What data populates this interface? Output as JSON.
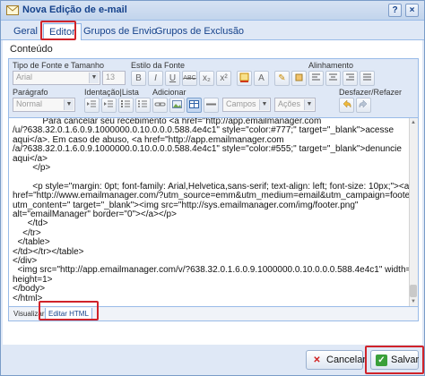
{
  "window": {
    "title": "Nova Edição de e-mail",
    "help_glyph": "?",
    "close_glyph": "×"
  },
  "tabs": [
    {
      "label": "Geral"
    },
    {
      "label": "Editor"
    },
    {
      "label": "Grupos de Envio"
    },
    {
      "label": "Grupos de Exclusão"
    }
  ],
  "panel": {
    "title": "Conteúdo"
  },
  "toolbar": {
    "labels": {
      "font_type_size": "Tipo de Fonte e Tamanho",
      "font_style": "Estilo da Fonte",
      "alignment": "Alinhamento",
      "paragraph": "Parágrafo",
      "indent_list": "Identação|Lista",
      "add": "Adicionar",
      "undo_redo": "Desfazer/Refazer"
    },
    "font_family": "Arial",
    "font_size": "13",
    "paragraph": "Normal",
    "fields": "Campos",
    "actions": "Ações",
    "style_buttons": [
      "B",
      "I",
      "U",
      "ABC",
      "x₂",
      "x²"
    ],
    "color_buttons": [
      "A",
      "✎"
    ]
  },
  "editor": {
    "lines": [
      "            Para cancelar seu recebimento <a href=\"http://app.emailmanager.com",
      "/u/?638.32.0.1.6.0.9.1000000.0.10.0.0.0.588.4e4c1\" style=\"color:#777;\" target=\"_blank\">acesse",
      "aqui</a>. Em caso de abuso, <a href=\"http://app.emailmanager.com",
      "/a/?638.32.0.1.6.0.9.1000000.0.10.0.0.0.588.4e4c1\" style=\"color:#555;\" target=\"_blank\">denuncie",
      "aqui</a>",
      "        </p>",
      "",
      "        <p style=\"margin: 0pt; font-family: Arial,Helvetica,sans-serif; text-align: left; font-size: 10px;\"><a",
      "href=\"http://www.emailmanager.com/?utm_source=emm&utm_medium=email&utm_campaign=footer&",
      "utm_content=\" target=\"_blank\"><img src=\"http://sys.emailmanager.com/img/footer.png\"",
      "alt=\"emailManager\" border=\"0\"></a></p>",
      "      </td>",
      "    </tr>",
      "  </table>",
      "</td></tr></table>",
      "</div>",
      "  <img src=\"http://app.emailmanager.com/v/?638.32.0.1.6.0.9.1000000.0.10.0.0.0.588.4e4c1\" width=1",
      "height=1>",
      "</body>",
      "</html>"
    ]
  },
  "bottom_tabs": [
    {
      "label": "Visualizar"
    },
    {
      "label": "Editar HTML"
    }
  ],
  "footer": {
    "cancel_label": "Cancelar",
    "save_label": "Salvar"
  },
  "colors": {
    "highlight": "#d0232a",
    "title_text": "#15428b",
    "chrome": "#dfe8f6"
  }
}
